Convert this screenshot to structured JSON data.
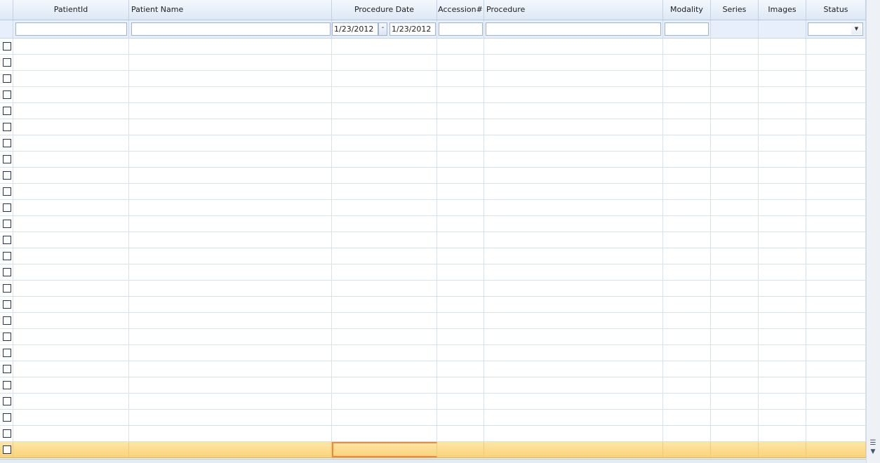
{
  "columns": [
    {
      "key": "select",
      "label": ""
    },
    {
      "key": "patient_id",
      "label": "PatientId"
    },
    {
      "key": "patient_name",
      "label": "Patient Name"
    },
    {
      "key": "procedure_date",
      "label": "Procedure Date"
    },
    {
      "key": "accession",
      "label": "Accession#"
    },
    {
      "key": "procedure",
      "label": "Procedure"
    },
    {
      "key": "modality",
      "label": "Modality"
    },
    {
      "key": "series",
      "label": "Series"
    },
    {
      "key": "images",
      "label": "Images"
    },
    {
      "key": "status",
      "label": "Status"
    }
  ],
  "filters": {
    "patient_id": "",
    "patient_name": "",
    "date_from": "1/23/2012",
    "date_separator": "-",
    "date_to": "1/23/2012",
    "accession": "",
    "procedure": "",
    "modality": "",
    "status": ""
  },
  "rows": {
    "count": 26,
    "selected_index": 25
  },
  "icons": {
    "status_dropdown": "chevron-down-icon",
    "scroll_menu": "menu-icon",
    "scroll_down": "arrow-down-icon"
  },
  "colors": {
    "header_bg": "#dde8f5",
    "filter_bg": "#e7f0fa",
    "selected_row": "#fbd27a",
    "active_cell_border": "#f0883c",
    "grid_lines": "#d6e1ee"
  }
}
